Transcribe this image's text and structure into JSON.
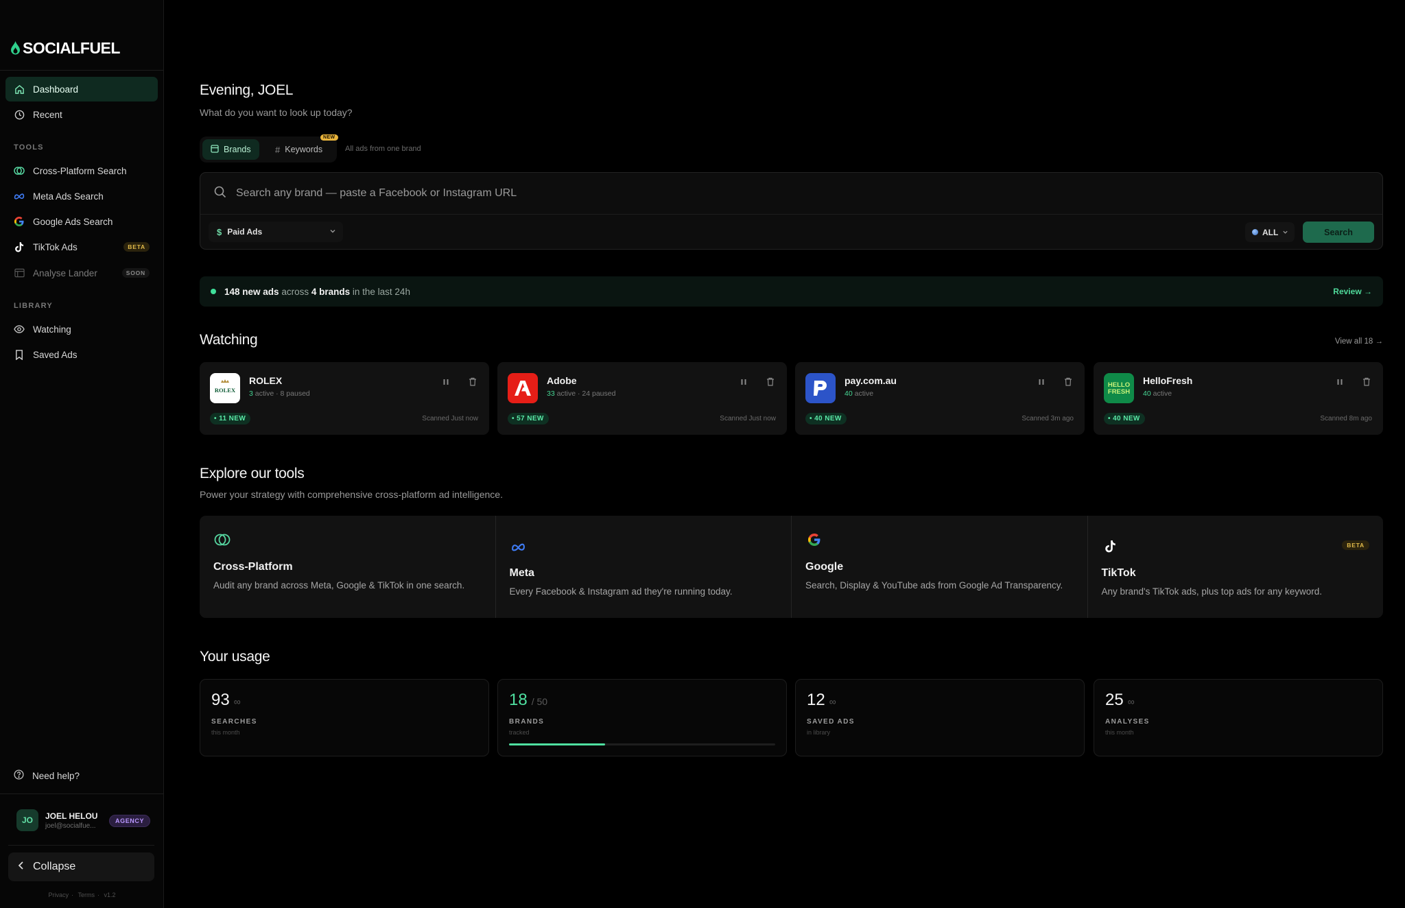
{
  "app": {
    "name": "SOCIALFUEL",
    "brand_color": "#2fd08c"
  },
  "sidebar": {
    "main": [
      {
        "label": "Dashboard",
        "icon": "home-icon",
        "active": true
      },
      {
        "label": "Recent",
        "icon": "clock-icon"
      }
    ],
    "tools_label": "TOOLS",
    "tools": [
      {
        "label": "Cross-Platform Search",
        "icon": "cross-platform-icon"
      },
      {
        "label": "Meta Ads Search",
        "icon": "meta-icon"
      },
      {
        "label": "Google Ads Search",
        "icon": "google-icon"
      },
      {
        "label": "TikTok Ads",
        "icon": "tiktok-icon",
        "badge": "BETA"
      },
      {
        "label": "Analyse Lander",
        "icon": "lander-icon",
        "badge": "SOON"
      }
    ],
    "library_label": "LIBRARY",
    "library": [
      {
        "label": "Watching",
        "icon": "eye-icon"
      },
      {
        "label": "Saved Ads",
        "icon": "bookmark-icon"
      }
    ],
    "help": "Need help?",
    "user": {
      "initials": "JO",
      "name": "JOEL HELOU",
      "email": "joel@socialfue...",
      "plan": "AGENCY"
    },
    "collapse": "Collapse",
    "footer": {
      "privacy": "Privacy",
      "terms": "Terms",
      "version": "v1.2"
    }
  },
  "main": {
    "greeting": "Evening, JOEL",
    "subgreeting": "What do you want to look up today?",
    "tabs": [
      {
        "label": "Brands",
        "icon": "grid-icon",
        "active": true
      },
      {
        "label": "Keywords",
        "icon": "hash-icon",
        "badge": "NEW"
      }
    ],
    "tab_hint": "All ads from one brand",
    "search": {
      "placeholder": "Search any brand — paste a Facebook or Instagram URL",
      "ad_type": "Paid Ads",
      "region": "ALL",
      "button": "Search"
    },
    "alert": {
      "count": "148 new ads",
      "across": "across",
      "brands": "4 brands",
      "suffix": "in the last 24h",
      "action": "Review →"
    },
    "watching": {
      "title": "Watching",
      "view_all": "View all 18 →",
      "brands": [
        {
          "name": "ROLEX",
          "active": "3",
          "active_label": "active",
          "paused": "· 8 paused",
          "new": "11 NEW",
          "scanned": "Scanned Just now",
          "logo": "rolex-logo"
        },
        {
          "name": "Adobe",
          "active": "33",
          "active_label": "active",
          "paused": "· 24 paused",
          "new": "57 NEW",
          "scanned": "Scanned Just now",
          "logo": "adobe-logo"
        },
        {
          "name": "pay.com.au",
          "active": "40",
          "active_label": "active",
          "paused": "",
          "new": "40 NEW",
          "scanned": "Scanned 3m ago",
          "logo": "paycomau-logo"
        },
        {
          "name": "HelloFresh",
          "active": "40",
          "active_label": "active",
          "paused": "",
          "new": "40 NEW",
          "scanned": "Scanned 8m ago",
          "logo": "hellofresh-logo"
        }
      ]
    },
    "explore": {
      "title": "Explore our tools",
      "subtitle": "Power your strategy with comprehensive cross-platform ad intelligence.",
      "tools": [
        {
          "title": "Cross-Platform",
          "desc": "Audit any brand across Meta, Google & TikTok in one search.",
          "icon": "cross-platform-icon"
        },
        {
          "title": "Meta",
          "desc": "Every Facebook & Instagram ad they're running today.",
          "icon": "meta-icon"
        },
        {
          "title": "Google",
          "desc": "Search, Display & YouTube ads from Google Ad Transparency.",
          "icon": "google-icon"
        },
        {
          "title": "TikTok",
          "desc": "Any brand's TikTok ads, plus top ads for any keyword.",
          "icon": "tiktok-icon",
          "badge": "BETA"
        }
      ]
    },
    "usage": {
      "title": "Your usage",
      "cards": [
        {
          "value": "93",
          "suffix": "∞",
          "label": "SEARCHES",
          "sub": "this month"
        },
        {
          "value": "18",
          "suffix": "/ 50",
          "label": "BRANDS",
          "sub": "tracked",
          "progress": 0.36
        },
        {
          "value": "12",
          "suffix": "∞",
          "label": "SAVED ADS",
          "sub": "in library"
        },
        {
          "value": "25",
          "suffix": "∞",
          "label": "ANALYSES",
          "sub": "this month"
        }
      ]
    }
  }
}
